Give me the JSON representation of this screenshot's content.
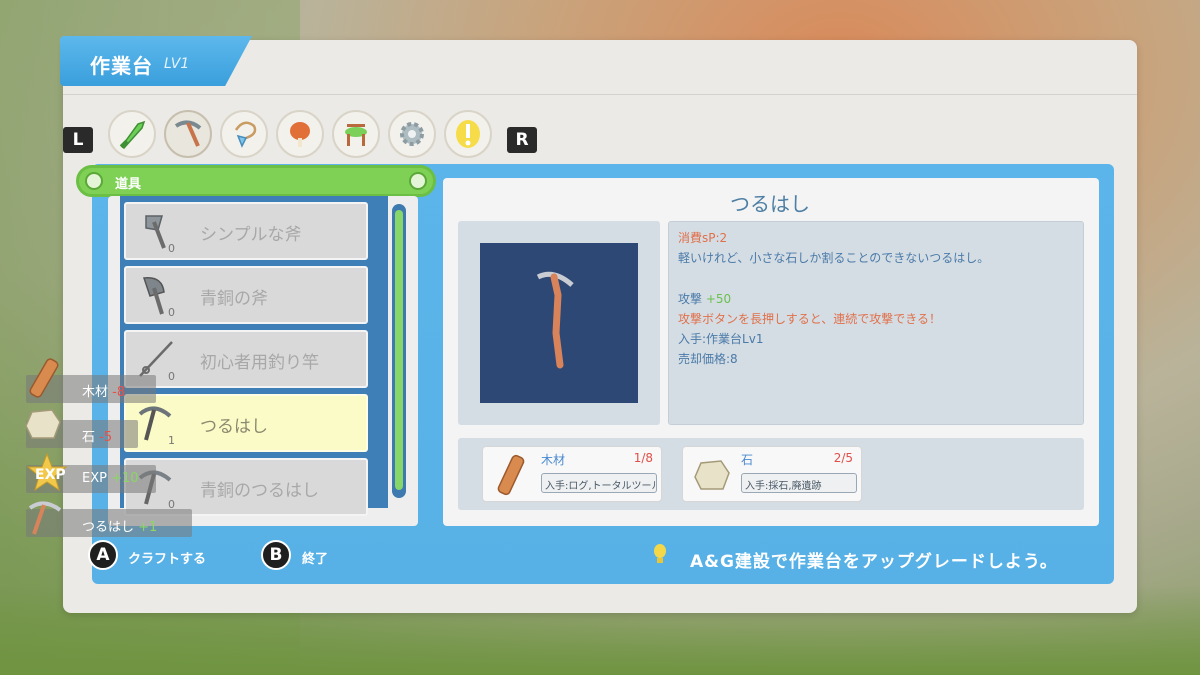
{
  "window": {
    "title": "作業台",
    "level": "LV1"
  },
  "tabs": {
    "left_button": "L",
    "right_button": "R",
    "categories": [
      {
        "icon": "weapon-icon",
        "active": false
      },
      {
        "icon": "pickaxe-icon",
        "active": true
      },
      {
        "icon": "accessory-icon",
        "active": false
      },
      {
        "icon": "food-icon",
        "active": false
      },
      {
        "icon": "furniture-icon",
        "active": false
      },
      {
        "icon": "gear-icon",
        "active": false
      },
      {
        "icon": "exclamation-icon",
        "active": false
      }
    ]
  },
  "category": {
    "label": "道具"
  },
  "list": {
    "items": [
      {
        "label": "シンプルな斧",
        "count": "0",
        "icon": "axe-icon",
        "selected": false
      },
      {
        "label": "青銅の斧",
        "count": "0",
        "icon": "bronze-axe-icon",
        "selected": false
      },
      {
        "label": "初心者用釣り竿",
        "count": "0",
        "icon": "fishing-rod-icon",
        "selected": false
      },
      {
        "label": "つるはし",
        "count": "1",
        "icon": "pickaxe-icon",
        "selected": true
      },
      {
        "label": "青銅のつるはし",
        "count": "0",
        "icon": "bronze-pickaxe-icon",
        "selected": false
      }
    ]
  },
  "detail": {
    "title": "つるはし",
    "cost": "消費sP:2",
    "description": "軽いけれど、小さな石しか割ることのできないつるはし。",
    "attack_label": "攻撃",
    "attack_value": "+50",
    "special": "攻撃ボタンを長押しすると、連続で攻撃できる！",
    "obtain": "入手:作業台Lv1",
    "sell_price": "売却価格:8"
  },
  "materials": [
    {
      "name": "木材",
      "count": "1/8",
      "source": "入手:ログ,トータルツール",
      "icon": "wood-icon"
    },
    {
      "name": "石",
      "count": "2/5",
      "source": "入手:採石,廃遺跡",
      "icon": "stone-icon"
    }
  ],
  "bottom": {
    "a_button": "A",
    "a_label": "クラフトする",
    "b_button": "B",
    "b_label": "終了",
    "tip": "A&G建設で作業台をアップグレードしよう。"
  },
  "notifications": [
    {
      "label": "木材",
      "delta": "-8",
      "type": "neg",
      "icon": "wood-icon"
    },
    {
      "label": "石",
      "delta": "-5",
      "type": "neg",
      "icon": "stone-icon"
    },
    {
      "label": "EXP",
      "delta": "+10",
      "type": "pos",
      "icon": "exp-star-icon",
      "icon_text": "EXP"
    },
    {
      "label": "つるはし",
      "delta": "+1",
      "type": "pos",
      "icon": "pickaxe-icon"
    }
  ],
  "colors": {
    "accent_blue": "#58b1e6",
    "category_green": "#7fd156",
    "selected_row": "#fbfbc7",
    "negative": "#e8514b",
    "positive": "#8ad764",
    "cost_text": "#e0704a",
    "desc_text": "#4a7aa8"
  }
}
